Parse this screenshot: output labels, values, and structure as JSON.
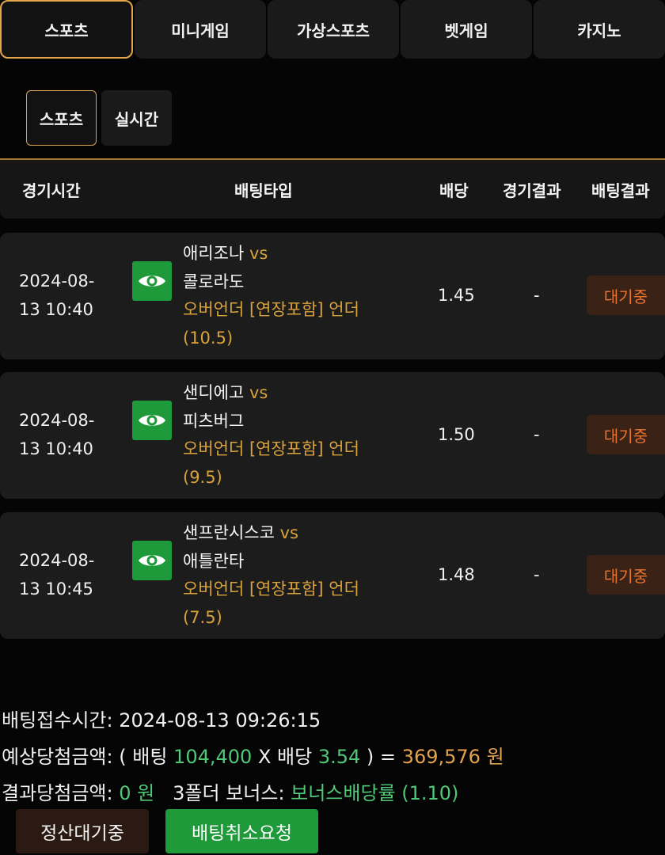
{
  "top_tabs": [
    "스포츠",
    "미니게임",
    "가상스포츠",
    "벳게임",
    "카지노"
  ],
  "sub_tabs": [
    "스포츠",
    "실시간"
  ],
  "table": {
    "headers": [
      "경기시간",
      "배팅타입",
      "배당",
      "경기결과",
      "배팅결과"
    ],
    "rows": [
      {
        "time_date": "2024-08-",
        "time_rest": "13 10:40",
        "team_home": "애리조나",
        "vs": "vs",
        "team_away": "콜로라도",
        "bet_type_line1": "오버언더 [연장포함] 언더",
        "bet_type_line2": "(10.5)",
        "odds": "1.45",
        "result": "-",
        "status": "대기중"
      },
      {
        "time_date": "2024-08-",
        "time_rest": "13 10:40",
        "team_home": "샌디에고",
        "vs": "vs",
        "team_away": "피츠버그",
        "bet_type_line1": "오버언더 [연장포함] 언더",
        "bet_type_line2": "(9.5)",
        "odds": "1.50",
        "result": "-",
        "status": "대기중"
      },
      {
        "time_date": "2024-08-",
        "time_rest": "13 10:45",
        "team_home": "샌프란시스코",
        "vs": "vs",
        "team_away": "애틀란타",
        "bet_type_line1": "오버언더 [연장포함] 언더",
        "bet_type_line2": "(7.5)",
        "odds": "1.48",
        "result": "-",
        "status": "대기중"
      }
    ]
  },
  "summary": {
    "bet_time_label": "배팅접수시간:",
    "bet_time_value": "2024-08-13 09:26:15",
    "expected_label": "예상당첨금액:",
    "open_paren": "(",
    "bet_label": "배팅",
    "bet_amount": "104,400",
    "times": "X",
    "odds_label": "배당",
    "total_odds": "3.54",
    "close_paren_eq": ") =",
    "expected_amount": "369,576",
    "won": "원",
    "result_label": "결과당첨금액:",
    "result_amount": "0 원",
    "bonus_label": "3폴더 보너스:",
    "bonus_value": "보너스배당률 (1.10)"
  },
  "buttons": {
    "settle_wait": "정산대기중",
    "cancel_request": "배팅취소요청"
  },
  "colors": {
    "accent_gold": "#d9a23a",
    "green": "#1f9a3a",
    "status_orange": "#e8742e"
  },
  "icons": {
    "view": "eye-icon"
  }
}
